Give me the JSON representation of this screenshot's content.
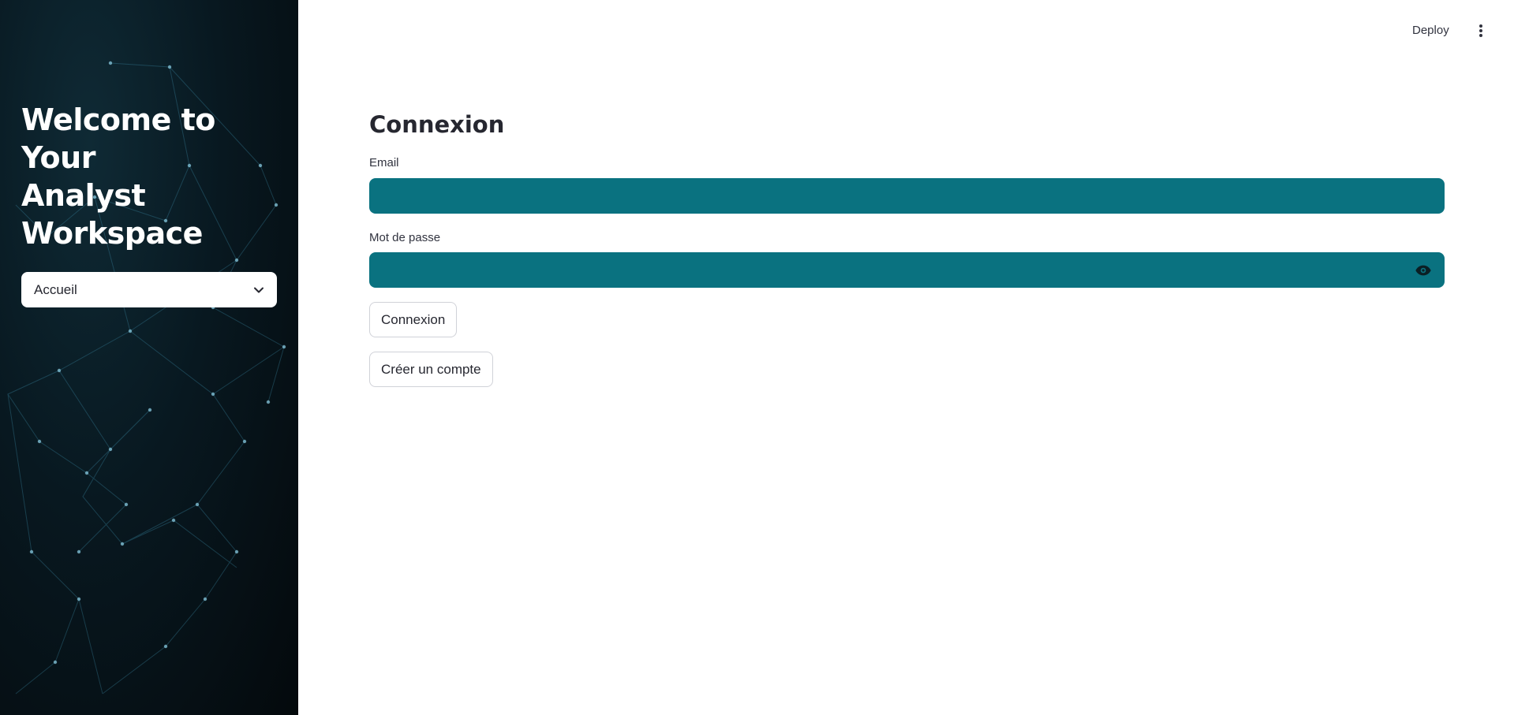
{
  "sidebar": {
    "title_lines": [
      "Welcome to Your",
      "Analyst",
      "Workspace"
    ],
    "nav_select": {
      "value": "Accueil",
      "icon": "chevron-down-icon"
    },
    "background": "network-mesh"
  },
  "header": {
    "deploy_label": "Deploy",
    "menu_icon": "kebab-menu-icon"
  },
  "main": {
    "title": "Connexion",
    "email": {
      "label": "Email",
      "value": "",
      "placeholder": ""
    },
    "password": {
      "label": "Mot de passe",
      "value": "",
      "placeholder": "",
      "toggle_icon": "eye-icon"
    },
    "login_button": "Connexion",
    "create_account_button": "Créer un compte"
  },
  "colors": {
    "input_fill": "#0a7280",
    "sidebar_bg": "#061219",
    "page_bg": "#ffffff"
  }
}
